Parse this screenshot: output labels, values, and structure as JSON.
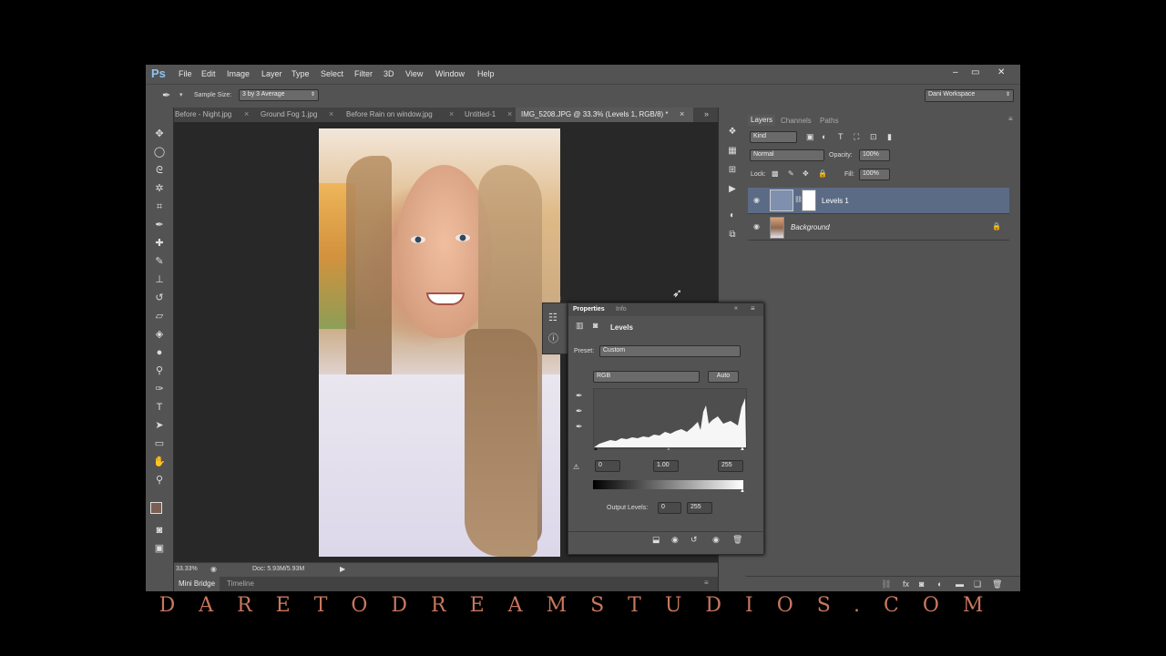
{
  "menubar": {
    "logo": "Ps",
    "items": [
      "File",
      "Edit",
      "Image",
      "Layer",
      "Type",
      "Select",
      "Filter",
      "3D",
      "View",
      "Window",
      "Help"
    ],
    "window_buttons": [
      "–",
      "▭",
      "✕"
    ]
  },
  "options": {
    "sample_size_label": "Sample Size:",
    "sample_size_value": "3 by 3 Average",
    "workspace": "Dani Workspace"
  },
  "tabs": [
    {
      "label": "Before - Night.jpg"
    },
    {
      "label": "Ground Fog 1.jpg"
    },
    {
      "label": "Before Rain on window.jpg"
    },
    {
      "label": "Untitled-1"
    },
    {
      "label": "IMG_5208.JPG @ 33.3% (Levels 1, RGB/8) *"
    }
  ],
  "status": {
    "zoom": "33.33%",
    "doc": "Doc: 5.93M/5.93M"
  },
  "bottom_tabs": [
    "Mini Bridge",
    "Timeline"
  ],
  "layers_panel": {
    "tabs": [
      "Layers",
      "Channels",
      "Paths"
    ],
    "filter_kind": "Kind",
    "blend_mode": "Normal",
    "opacity_label": "Opacity:",
    "opacity_value": "100%",
    "lock_label": "Lock:",
    "fill_label": "Fill:",
    "fill_value": "100%",
    "layers": [
      {
        "name": "Levels 1"
      },
      {
        "name": "Background"
      }
    ]
  },
  "properties": {
    "tabs": [
      "Properties",
      "Info"
    ],
    "title": "Levels",
    "preset_label": "Preset:",
    "preset_value": "Custom",
    "channel": "RGB",
    "auto_label": "Auto",
    "input_black": "0",
    "input_gamma": "1.00",
    "input_white": "255",
    "output_label": "Output Levels:",
    "output_black": "0",
    "output_white": "255"
  },
  "watermark": "DARETODREAMSTUDIOS.COM",
  "colors": {
    "ui_dark": "#535353",
    "ui_bg": "#3c3c3c",
    "selected_layer": "#5b6b85",
    "watermark": "#c8775e"
  }
}
